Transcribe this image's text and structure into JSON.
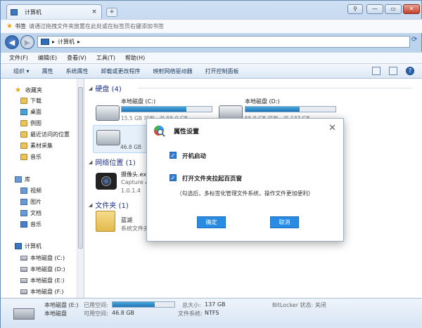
{
  "tab": {
    "title": "计算机"
  },
  "bookmarks": {
    "label": "书签",
    "hint": "请通过拖拽文件夹放置在此处或在标签页右键添加书签"
  },
  "address": {
    "crumbs": [
      "▸",
      "计算机",
      "▸"
    ]
  },
  "menu": [
    "文件(F)",
    "编辑(E)",
    "查看(V)",
    "工具(T)",
    "帮助(H)"
  ],
  "commands": [
    "组织 ▾",
    "属性",
    "系统属性",
    "卸载或更改程序",
    "映射网络驱动器",
    "打开控制面板"
  ],
  "sidebar": {
    "favorites_header": "收藏夹",
    "favorites": [
      "下载",
      "桌面",
      "例图",
      "最近访问的位置",
      "素材采集",
      "音乐"
    ],
    "library_header": "库",
    "library": [
      "视频",
      "图片",
      "文档",
      "音乐"
    ],
    "computer_header": "计算机",
    "drives": [
      "本地磁盘 (C:)",
      "本地磁盘 (D:)",
      "本地磁盘 (E:)",
      "本地磁盘 (F:)"
    ]
  },
  "main": {
    "group_disks": "硬盘 (4)",
    "group_network": "网络位置 (1)",
    "group_folders": "文件夹 (1)",
    "drive_c": {
      "name": "本地磁盘 (C:)",
      "size": "15.5 GB 可用，共 55.0 GB",
      "used_fraction": 0.72
    },
    "drive_d": {
      "name": "本地磁盘 (D:)",
      "size": "55.9 GB 可用，共 137 GB",
      "used_fraction": 0.6
    },
    "drive_e": {
      "size": "46.8 GB"
    },
    "network": {
      "name": "摄像头.exe",
      "line2": "Capture A",
      "line3": "1.0.1.4"
    },
    "folder": {
      "name": "蓝湖",
      "line2": "系统文件夹"
    }
  },
  "status": {
    "drive": "本地磁盘 (E:)",
    "drive_sub": "本地磁盘",
    "used_label": "已用空间:",
    "free_label": "可用空间:",
    "free_value": "46.8 GB",
    "total_label": "总大小:",
    "total_value": "137 GB",
    "fs_label": "文件系统:",
    "fs_value": "NTFS",
    "bitlocker": "BitLocker 状态: 关闭",
    "used_fraction": 0.68
  },
  "dialog": {
    "title": "属性设置",
    "opt1": "开机启动",
    "opt2": "打开文件夹拉起百页窗",
    "note": "（勾选后，多标签化管理文件系统，操作文件更加便利）",
    "ok": "确定",
    "cancel": "取消",
    "checkmark": "✓"
  }
}
